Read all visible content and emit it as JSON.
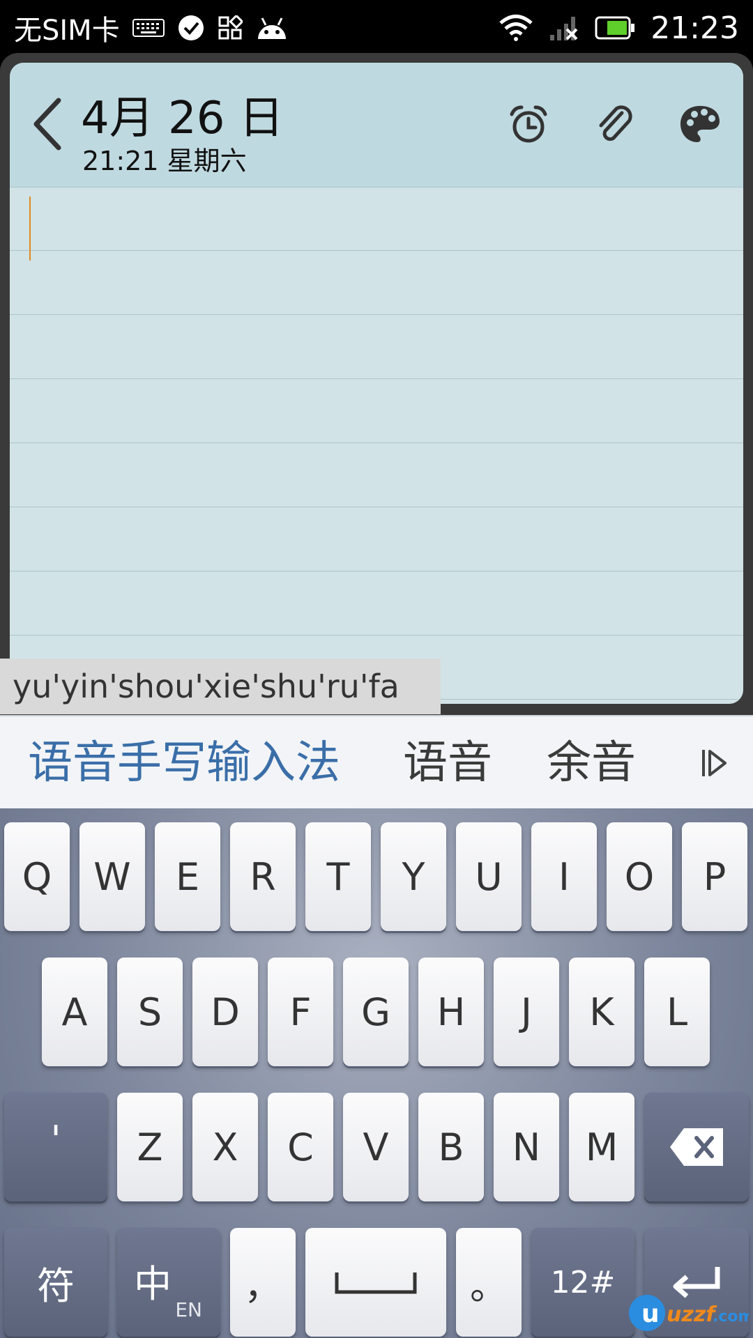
{
  "status_bar": {
    "carrier": "无SIM卡",
    "time": "21:23",
    "icons": [
      "keyboard-icon",
      "check-circle-icon",
      "apps-icon",
      "android-icon",
      "wifi-icon",
      "no-signal-icon",
      "battery-icon"
    ]
  },
  "note": {
    "date": "4月 26 日",
    "subtitle": "21:21 星期六",
    "header_icons": [
      "alarm-icon",
      "attachment-icon",
      "palette-icon"
    ],
    "content": ""
  },
  "ime": {
    "composing": "yu'yin'shou'xie'shu'ru'fa",
    "candidates": [
      "语音手写输入法",
      "语音",
      "余音"
    ],
    "more_icon": "expand-candidates-icon",
    "rows": [
      [
        "Q",
        "W",
        "E",
        "R",
        "T",
        "Y",
        "U",
        "I",
        "O",
        "P"
      ],
      [
        "A",
        "S",
        "D",
        "F",
        "G",
        "H",
        "J",
        "K",
        "L"
      ],
      [
        "Z",
        "X",
        "C",
        "V",
        "B",
        "N",
        "M"
      ]
    ],
    "apostrophe": "'",
    "symbols_key": "符",
    "lang_key": "中",
    "lang_sub": "EN",
    "comma": "，",
    "period": "。",
    "numbers_key": "12#"
  },
  "colors": {
    "note_bg": "#d2e3e7",
    "header_bg": "#bfd9e0",
    "candidate_highlight": "#3a6ea8",
    "caret": "#e08a1e"
  },
  "watermark": {
    "text": "uzzf.com"
  }
}
